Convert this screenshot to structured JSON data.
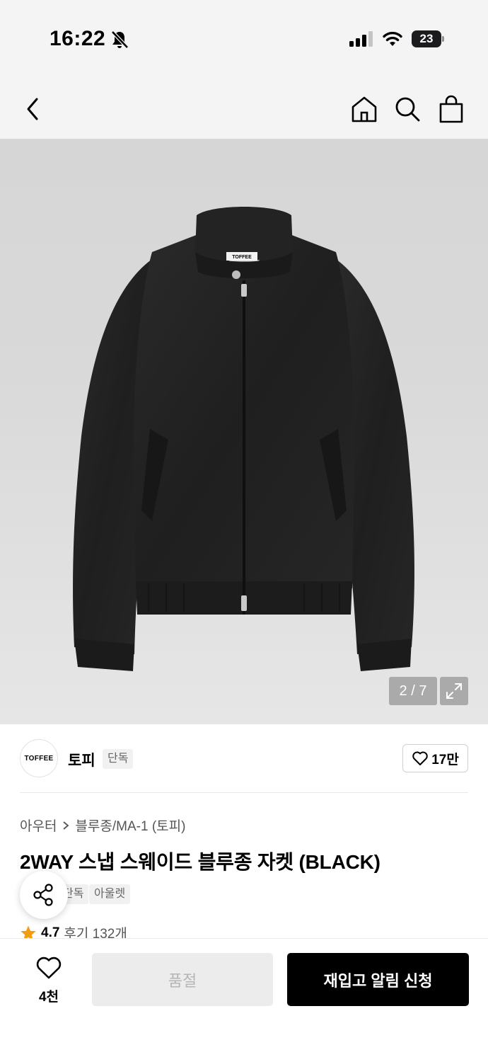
{
  "status_bar": {
    "time": "16:22",
    "battery": "23"
  },
  "nav": {
    "icons": [
      "back-icon",
      "home-icon",
      "search-icon",
      "shopping-bag-icon"
    ]
  },
  "gallery": {
    "pager": "2 / 7",
    "brand_label": "TOFFEE"
  },
  "brand": {
    "logo_text": "TOFFEE",
    "name": "토피",
    "tag": "단독",
    "likes": "17만"
  },
  "product": {
    "breadcrumb": [
      "아우터",
      "블루종/MA-1 (토피)"
    ],
    "title": "2WAY 스냅 스웨이드 블루종 자켓 (BLACK)",
    "tags": [
      "단독",
      "아울렛"
    ],
    "rating": "4.7",
    "reviews": "후기 132개"
  },
  "bottom_bar": {
    "wish_count": "4천",
    "soldout_label": "품절",
    "restock_label": "재입고 알림 신청"
  },
  "colors": {
    "accent_black": "#000000",
    "star": "#f39c12",
    "soldout_bg": "#ececec"
  }
}
